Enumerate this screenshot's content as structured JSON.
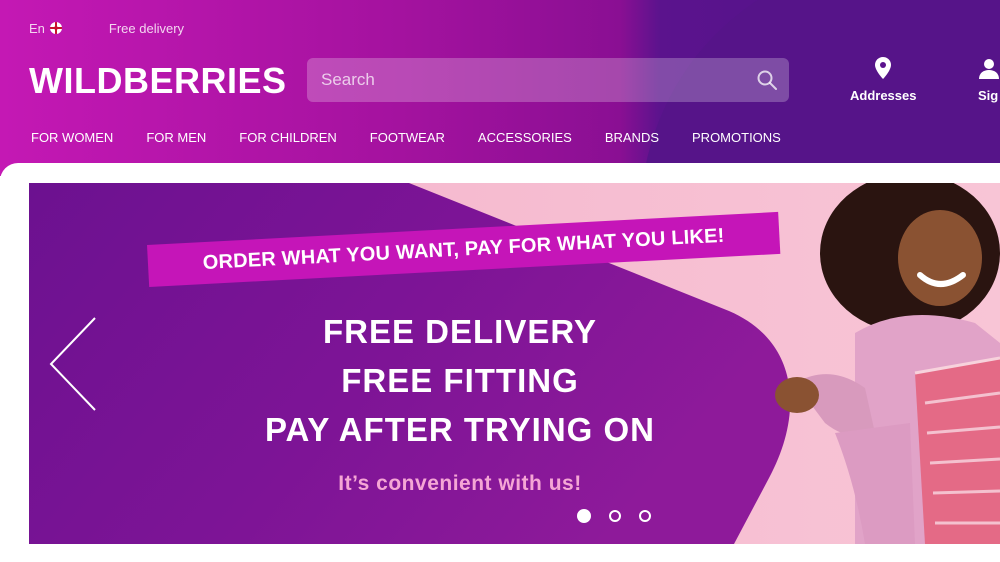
{
  "topbar": {
    "language": "En",
    "free_delivery": "Free delivery"
  },
  "logo": {
    "text": "WILDBERRIES"
  },
  "search": {
    "placeholder": "Search"
  },
  "header_buttons": {
    "addresses": "Addresses",
    "signin": "Sig"
  },
  "nav": {
    "items": [
      "FOR WOMEN",
      "FOR MEN",
      "FOR CHILDREN",
      "FOOTWEAR",
      "ACCESSORIES",
      "BRANDS",
      "PROMOTIONS"
    ]
  },
  "banner": {
    "tagline": "ORDER WHAT YOU WANT, PAY FOR WHAT YOU LIKE!",
    "headline": [
      "FREE DELIVERY",
      "FREE FITTING",
      "PAY AFTER TRYING ON"
    ],
    "subtext": "It’s convenient with us!",
    "slides": 3,
    "active_slide": 1
  },
  "colors": {
    "header_start": "#c418b4",
    "header_end": "#4e148a",
    "banner_purple": "#7a1294",
    "banner_pink": "#f6b7cf",
    "tagline_bg": "#c515b8",
    "subtext": "#f5a6d5"
  },
  "icons": {
    "search": "search-icon",
    "location": "location-pin-icon",
    "user": "user-icon",
    "prev": "chevron-left-icon",
    "flag": "uk-flag-icon"
  }
}
